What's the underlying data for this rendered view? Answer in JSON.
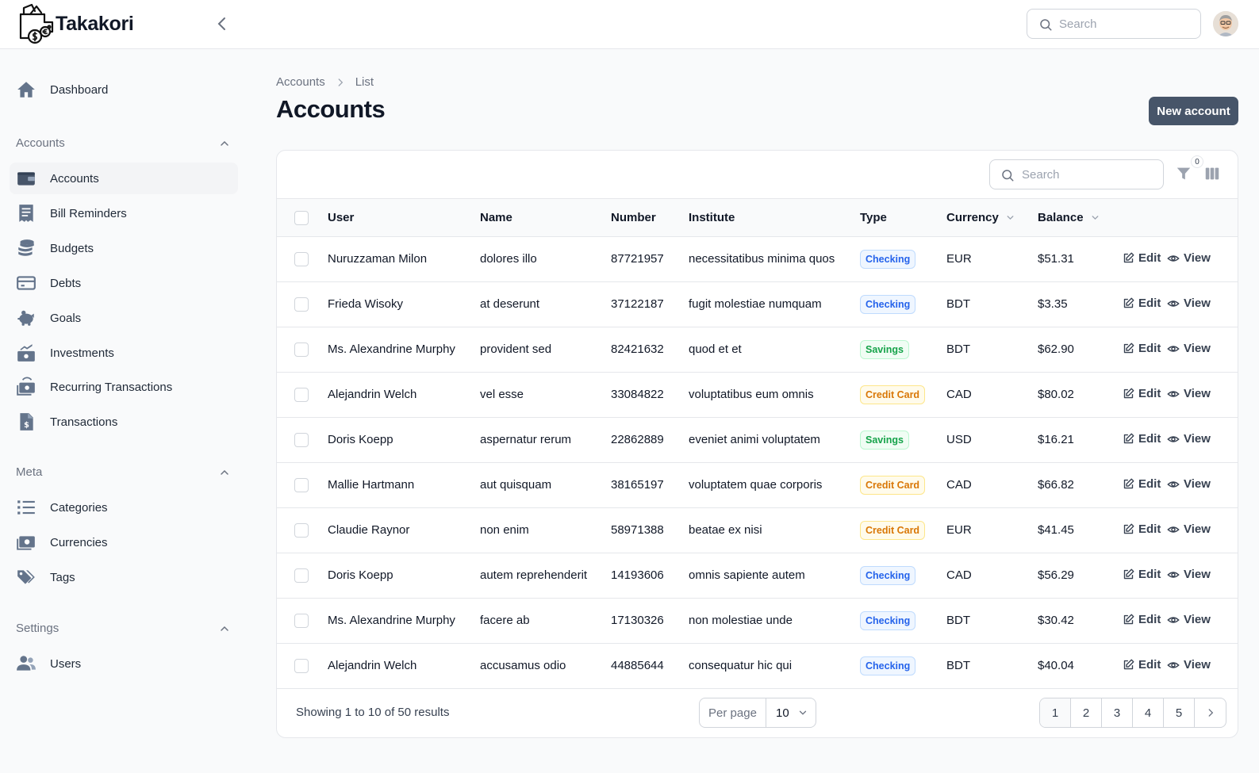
{
  "app": {
    "brand": "Takakori"
  },
  "topbar": {
    "search_placeholder": "Search"
  },
  "sidebar": {
    "dashboard": "Dashboard",
    "groups": [
      {
        "label": "Accounts",
        "items": [
          "Accounts",
          "Bill Reminders",
          "Budgets",
          "Debts",
          "Goals",
          "Investments",
          "Recurring Transactions",
          "Transactions"
        ]
      },
      {
        "label": "Meta",
        "items": [
          "Categories",
          "Currencies",
          "Tags"
        ]
      },
      {
        "label": "Settings",
        "items": [
          "Users"
        ]
      }
    ]
  },
  "breadcrumb": {
    "parent": "Accounts",
    "current": "List"
  },
  "page": {
    "title": "Accounts",
    "new_button": "New account"
  },
  "table": {
    "search_placeholder": "Search",
    "filter_count": "0",
    "columns": {
      "user": "User",
      "name": "Name",
      "number": "Number",
      "institute": "Institute",
      "type": "Type",
      "currency": "Currency",
      "balance": "Balance"
    },
    "edit_label": "Edit",
    "view_label": "View",
    "rows": [
      {
        "user": "Nuruzzaman Milon",
        "name": "dolores illo",
        "number": "87721957",
        "institute": "necessitatibus minima quos",
        "type": "Checking",
        "currency": "EUR",
        "balance": "$51.31"
      },
      {
        "user": "Frieda Wisoky",
        "name": "at deserunt",
        "number": "37122187",
        "institute": "fugit molestiae numquam",
        "type": "Checking",
        "currency": "BDT",
        "balance": "$3.35"
      },
      {
        "user": "Ms. Alexandrine Murphy",
        "name": "provident sed",
        "number": "82421632",
        "institute": "quod et et",
        "type": "Savings",
        "currency": "BDT",
        "balance": "$62.90"
      },
      {
        "user": "Alejandrin Welch",
        "name": "vel esse",
        "number": "33084822",
        "institute": "voluptatibus eum omnis",
        "type": "Credit Card",
        "currency": "CAD",
        "balance": "$80.02"
      },
      {
        "user": "Doris Koepp",
        "name": "aspernatur rerum",
        "number": "22862889",
        "institute": "eveniet animi voluptatem",
        "type": "Savings",
        "currency": "USD",
        "balance": "$16.21"
      },
      {
        "user": "Mallie Hartmann",
        "name": "aut quisquam",
        "number": "38165197",
        "institute": "voluptatem quae corporis",
        "type": "Credit Card",
        "currency": "CAD",
        "balance": "$66.82"
      },
      {
        "user": "Claudie Raynor",
        "name": "non enim",
        "number": "58971388",
        "institute": "beatae ex nisi",
        "type": "Credit Card",
        "currency": "EUR",
        "balance": "$41.45"
      },
      {
        "user": "Doris Koepp",
        "name": "autem reprehenderit",
        "number": "14193606",
        "institute": "omnis sapiente autem",
        "type": "Checking",
        "currency": "CAD",
        "balance": "$56.29"
      },
      {
        "user": "Ms. Alexandrine Murphy",
        "name": "facere ab",
        "number": "17130326",
        "institute": "non molestiae unde",
        "type": "Checking",
        "currency": "BDT",
        "balance": "$30.42"
      },
      {
        "user": "Alejandrin Welch",
        "name": "accusamus odio",
        "number": "44885644",
        "institute": "consequatur hic qui",
        "type": "Checking",
        "currency": "BDT",
        "balance": "$40.04"
      }
    ]
  },
  "footer": {
    "summary": "Showing 1 to 10 of 50 results",
    "per_page_label": "Per page",
    "per_page_value": "10",
    "pages": [
      "1",
      "2",
      "3",
      "4",
      "5"
    ]
  },
  "colors": {
    "primary_button": "#475569",
    "checking": "#2563eb",
    "savings": "#16a34a",
    "credit_card": "#d97706"
  }
}
